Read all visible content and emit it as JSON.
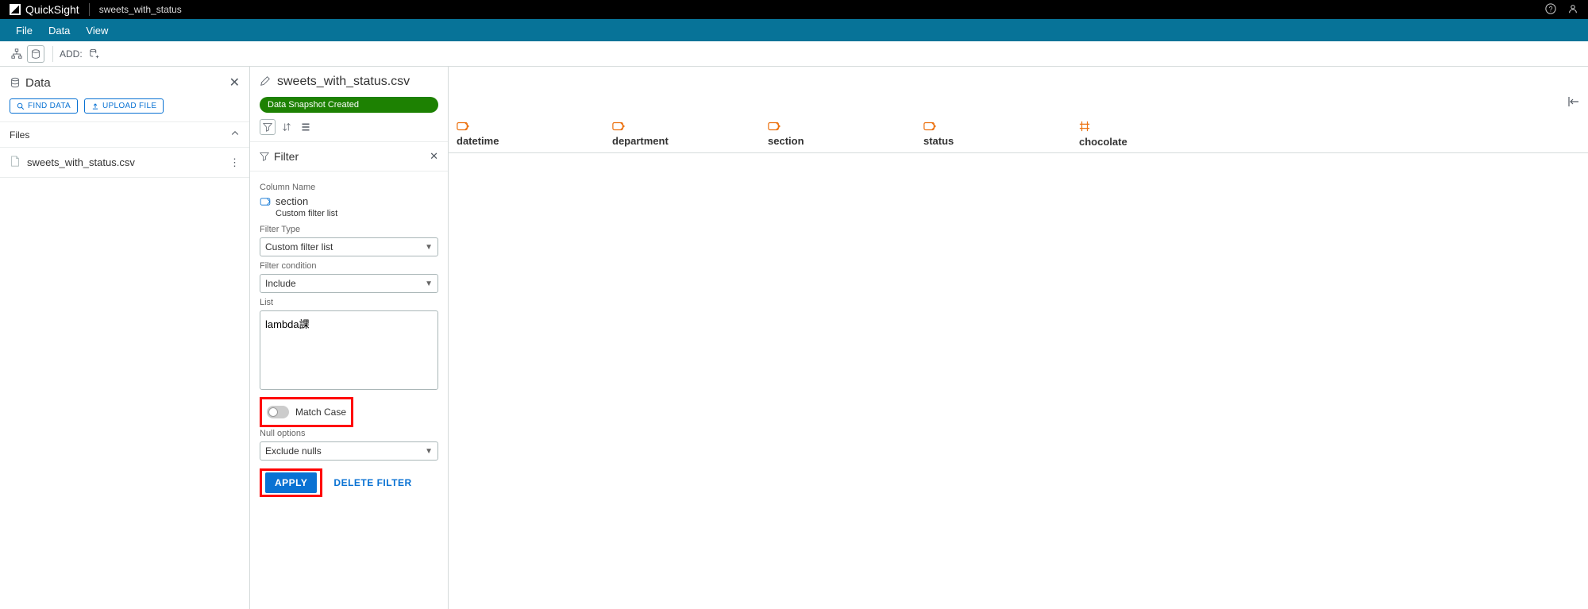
{
  "topbar": {
    "brand": "QuickSight",
    "dataset_name": "sweets_with_status"
  },
  "menubar": {
    "file": "File",
    "data": "Data",
    "view": "View"
  },
  "toolbar": {
    "add_label": "ADD:"
  },
  "sidebar": {
    "title": "Data",
    "find_btn": "FIND DATA",
    "upload_btn": "UPLOAD FILE",
    "files_title": "Files",
    "file_item": "sweets_with_status.csv"
  },
  "mid": {
    "filename": "sweets_with_status.csv",
    "snapshot_badge": "Data Snapshot Created",
    "filter_title": "Filter",
    "column_name_label": "Column Name",
    "column_name_value": "section",
    "column_sub": "Custom filter list",
    "filter_type_label": "Filter Type",
    "filter_type_value": "Custom filter list",
    "filter_condition_label": "Filter condition",
    "filter_condition_value": "Include",
    "list_label": "List",
    "list_value": "lambda課",
    "match_case": "Match Case",
    "null_options_label": "Null options",
    "null_options_value": "Exclude nulls",
    "apply_btn": "APPLY",
    "delete_btn": "DELETE FILTER"
  },
  "data_columns": [
    {
      "name": "datetime",
      "type": "string"
    },
    {
      "name": "department",
      "type": "string"
    },
    {
      "name": "section",
      "type": "string"
    },
    {
      "name": "status",
      "type": "string"
    },
    {
      "name": "chocolate",
      "type": "number"
    }
  ]
}
